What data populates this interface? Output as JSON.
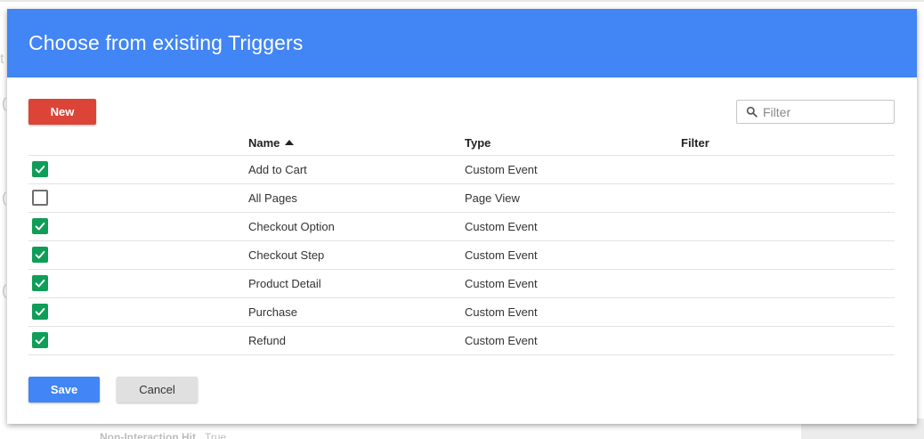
{
  "background": {
    "fragments": [
      "t",
      "(",
      "(",
      "("
    ],
    "bottom_label": "Non-Interaction Hit",
    "bottom_value": "True"
  },
  "dialog": {
    "title": "Choose from existing Triggers",
    "header_color": "#4285f4",
    "new_label": "New",
    "filter_placeholder": "Filter",
    "columns": {
      "name": "Name",
      "type": "Type",
      "filter": "Filter"
    },
    "sort": {
      "column": "Name",
      "direction": "ascending"
    },
    "rows": [
      {
        "checked": true,
        "name": "Add to Cart",
        "type": "Custom Event",
        "filter": ""
      },
      {
        "checked": false,
        "name": "All Pages",
        "type": "Page View",
        "filter": ""
      },
      {
        "checked": true,
        "name": "Checkout Option",
        "type": "Custom Event",
        "filter": ""
      },
      {
        "checked": true,
        "name": "Checkout Step",
        "type": "Custom Event",
        "filter": ""
      },
      {
        "checked": true,
        "name": "Product Detail",
        "type": "Custom Event",
        "filter": ""
      },
      {
        "checked": true,
        "name": "Purchase",
        "type": "Custom Event",
        "filter": ""
      },
      {
        "checked": true,
        "name": "Refund",
        "type": "Custom Event",
        "filter": ""
      }
    ],
    "save_label": "Save",
    "cancel_label": "Cancel"
  },
  "colors": {
    "new_button": "#db4437",
    "save_button": "#4285f4",
    "checkbox_checked": "#0f9d58"
  }
}
